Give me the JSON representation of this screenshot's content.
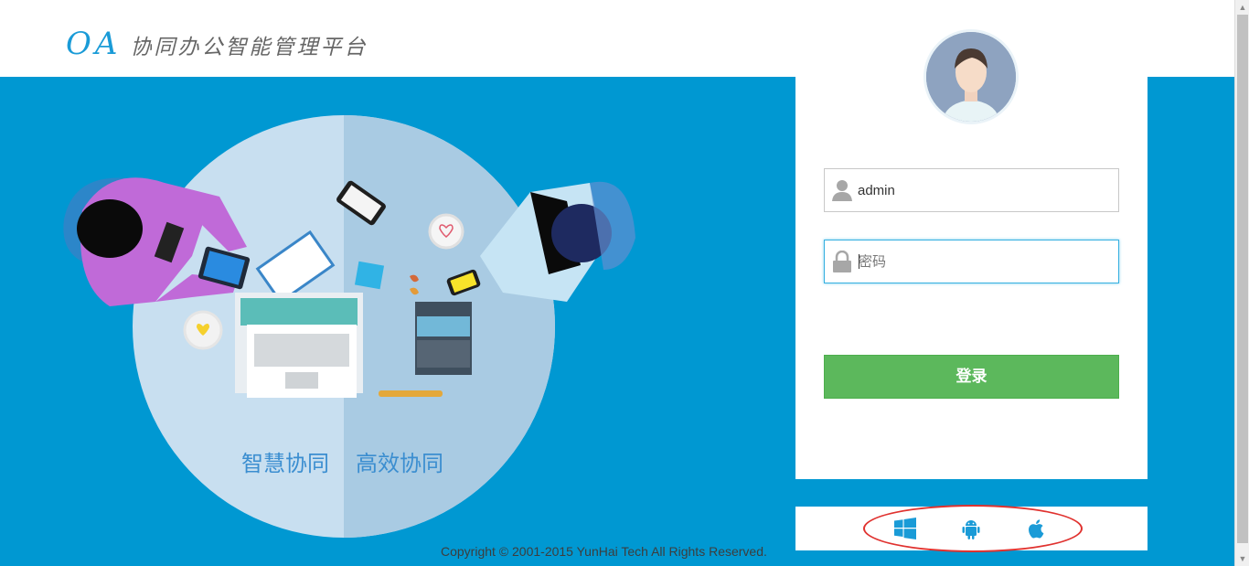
{
  "header": {
    "logo_oa": "OA",
    "logo_text": "协同办公智能管理平台"
  },
  "illustration": {
    "slogan_1": "智慧协同",
    "slogan_2": "高效协同"
  },
  "login": {
    "username_value": "admin",
    "password_placeholder": "密码",
    "submit_label": "登录"
  },
  "platforms": {
    "icons": [
      "windows-icon",
      "android-icon",
      "apple-icon"
    ]
  },
  "footer": {
    "copyright": "Copyright © 2001-2015 YunHai Tech All Rights Reserved."
  },
  "colors": {
    "brand_blue": "#0098d2",
    "login_green": "#5cb85c",
    "annotation_red": "#e0322f"
  }
}
